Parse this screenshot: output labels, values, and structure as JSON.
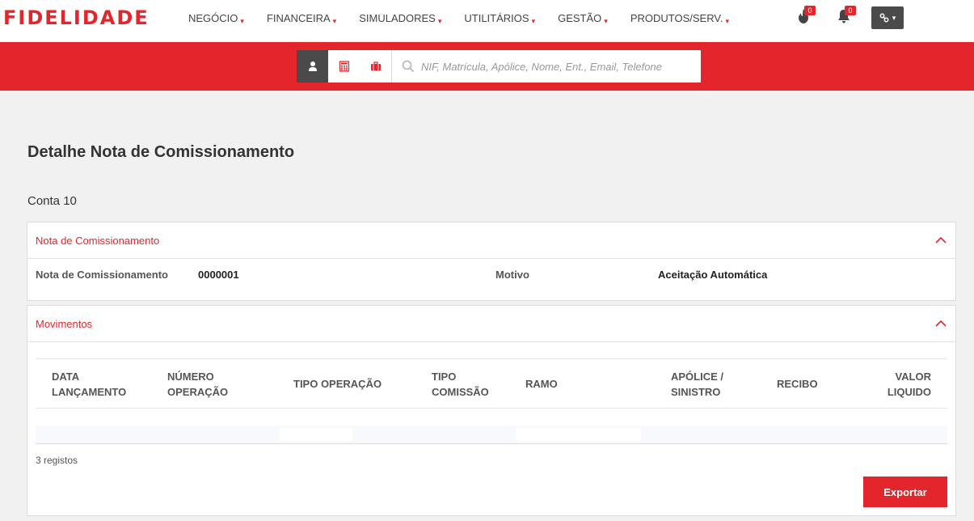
{
  "brand": {
    "logo_text": "FIDELIDADE",
    "accent": "#e3262b",
    "dark": "#4a4a4a"
  },
  "nav": {
    "items": [
      {
        "label": "NEGÓCIO"
      },
      {
        "label": "FINANCEIRA"
      },
      {
        "label": "SIMULADORES"
      },
      {
        "label": "UTILITÁRIOS"
      },
      {
        "label": "GESTÃO"
      },
      {
        "label": "PRODUTOS/SERV."
      }
    ],
    "caret": "▾",
    "fire_badge": "0",
    "bell_badge": "0",
    "tools_caret": "▾"
  },
  "search": {
    "placeholder": "NIF, Matrícula, Apólice, Nome, Ent., Email, Telefone",
    "tabs": [
      "person-icon",
      "calculator-icon",
      "briefcase-icon"
    ]
  },
  "page": {
    "title": "Detalhe Nota de Comissionamento",
    "account": "Conta 10"
  },
  "nota_panel": {
    "title": "Nota de Comissionamento",
    "fields": {
      "nota_label": "Nota de Comissionamento",
      "nota_value": "0000001",
      "motivo_label": "Motivo",
      "motivo_value": "Aceitação Automática"
    }
  },
  "movimentos_panel": {
    "title": "Movimentos",
    "columns": [
      {
        "line1": "DATA",
        "line2": "LANÇAMENTO"
      },
      {
        "line1": "NÚMERO",
        "line2": "OPERAÇÃO"
      },
      {
        "line1": "TIPO OPERAÇÃO",
        "line2": ""
      },
      {
        "line1": "TIPO",
        "line2": "COMISSÃO"
      },
      {
        "line1": "RAMO",
        "line2": ""
      },
      {
        "line1": "APÓLICE /",
        "line2": "SINISTRO"
      },
      {
        "line1": "RECIBO",
        "line2": ""
      },
      {
        "line1": "VALOR",
        "line2": "LIQUIDO"
      }
    ],
    "record_count": "3 registos",
    "export_label": "Exportar"
  }
}
